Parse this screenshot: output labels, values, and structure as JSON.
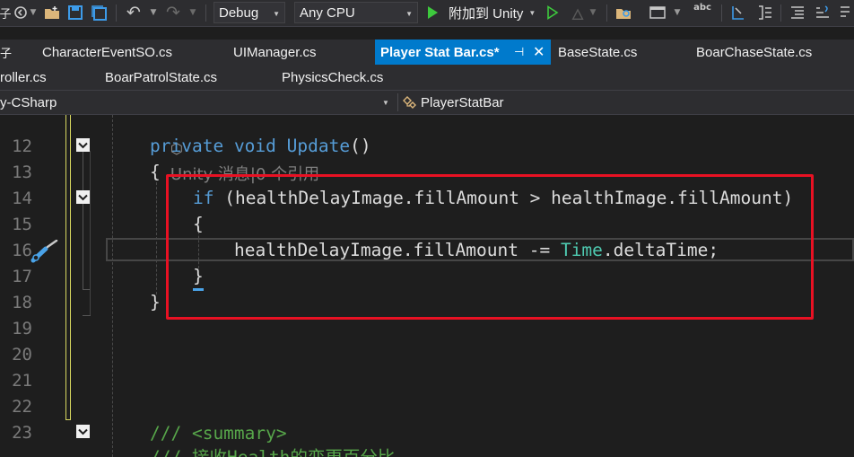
{
  "toolbar": {
    "left_glyph": "子",
    "config": "Debug",
    "platform": "Any CPU",
    "attach_label": "附加到 Unity",
    "icons": [
      "nav-back-icon",
      "new-file-icon",
      "open-folder-icon",
      "save-icon",
      "save-all-icon",
      "undo-icon",
      "redo-icon",
      "play-icon",
      "play-outline-icon",
      "flame-icon",
      "find-in-files-icon",
      "window-layout-icon",
      "spell-check-icon",
      "step-icon",
      "format-icon",
      "comment-icon",
      "uncomment-icon"
    ]
  },
  "tabs_row1": [
    {
      "label": "子",
      "active": false
    },
    {
      "label": "CharacterEventSO.cs",
      "active": false
    },
    {
      "label": "UIManager.cs",
      "active": false
    },
    {
      "label": "Player Stat Bar.cs*",
      "active": true
    },
    {
      "label": "BaseState.cs",
      "active": false
    },
    {
      "label": "BoarChaseState.cs",
      "active": false
    }
  ],
  "tabs_row2": [
    {
      "label": "roller.cs"
    },
    {
      "label": "BoarPatrolState.cs"
    },
    {
      "label": "PhysicsCheck.cs"
    }
  ],
  "active_tab_pin": "⊣",
  "active_tab_close": "✕",
  "nav": {
    "project": "y-CSharp",
    "class": "PlayerStatBar"
  },
  "editor": {
    "codelens": "Unity 消息|0 个引用",
    "line_numbers": [
      "12",
      "13",
      "14",
      "15",
      "16",
      "17",
      "18",
      "19",
      "20",
      "21",
      "22",
      "23"
    ],
    "lines": {
      "l12_kw1": "private",
      "l12_kw2": "void",
      "l12_name": "Update",
      "l12_paren": "()",
      "l13": "{",
      "l14_kw": "if",
      "l14_rest": " (healthDelayImage.fillAmount > healthImage.fillAmount)",
      "l15": "{",
      "l16_a": "healthDelayImage.fillAmount -= ",
      "l16_type": "Time",
      "l16_b": ".deltaTime;",
      "l17": "}",
      "l18": "}",
      "l23": "/// <summary>",
      "l24": "/// 接收Health的变更百分比"
    }
  },
  "colors": {
    "keyword": "#569cd6",
    "type": "#4ec9b0",
    "comment": "#57a64a",
    "highlight_box": "#e81123",
    "active_tab": "#007acc"
  }
}
